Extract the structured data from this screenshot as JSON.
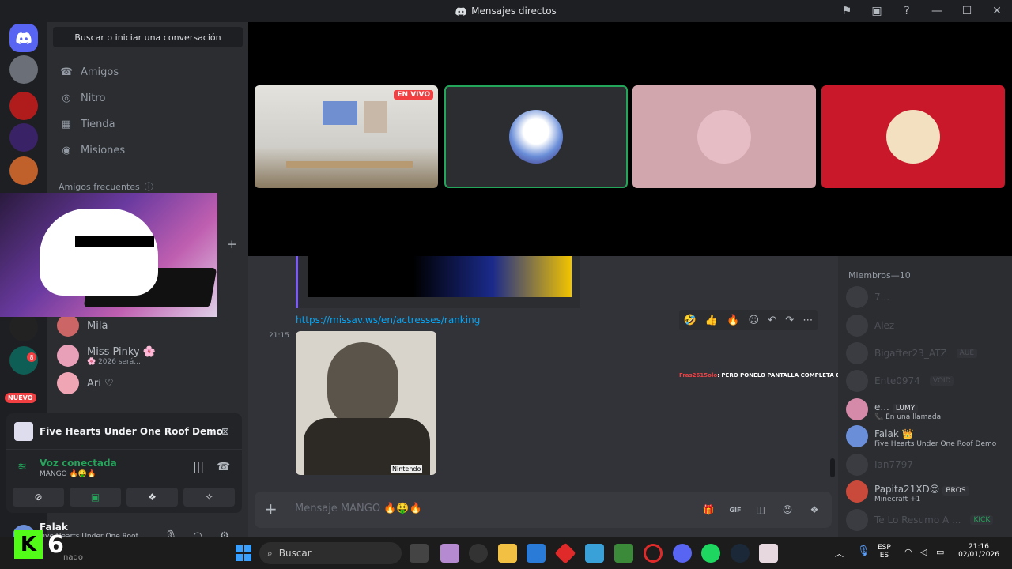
{
  "window": {
    "title": "Mensajes directos"
  },
  "sidebar": {
    "search_label": "Buscar o iniciar una conversación",
    "nav": [
      "Amigos",
      "Nitro",
      "Tienda",
      "Misiones"
    ],
    "section_title": "Amigos frecuentes",
    "dms": [
      {
        "name": "Mila",
        "sub": ""
      },
      {
        "name": "Miss Pinky 🌸",
        "sub": "🌸 2026 será..."
      },
      {
        "name": "Ari ♡",
        "sub": ""
      }
    ],
    "badge_new": "NUEVO",
    "badge_count": "8"
  },
  "activity": {
    "game": "Five Hearts Under One Roof Demo",
    "voice_status": "Voz conectada",
    "channel": "MANGO 🔥🤑🔥"
  },
  "user": {
    "name": "Falak",
    "status": "Five Hearts Under One Roof..."
  },
  "stream": {
    "live_label": "EN VIVO"
  },
  "chat": {
    "link": "https://missav.ws/en/actresses/ranking",
    "time": "21:15",
    "photo_caption": "Nintendo",
    "comment_user": "Fras2615olo",
    "comment_text": ": PERO PONELO PANTALLA COMPLETA QE ME AGO PAJA",
    "placeholder": "Mensaje MANGO 🔥🤑🔥"
  },
  "members": {
    "title": "Miembros—10",
    "list": [
      {
        "name": "7...",
        "sub": "",
        "tag": ""
      },
      {
        "name": "Alez",
        "sub": "",
        "tag": ""
      },
      {
        "name": "Bigafter23_ATZ",
        "sub": "",
        "tag": "AUE"
      },
      {
        "name": "Ente0974",
        "sub": "",
        "tag": "VOID"
      },
      {
        "name": "e...",
        "sub": "📞 En una llamada",
        "tag": "LUMY"
      },
      {
        "name": "Falak 👑",
        "sub": "Five Hearts Under One Roof Demo",
        "tag": ""
      },
      {
        "name": "Ian7797",
        "sub": "",
        "tag": ""
      },
      {
        "name": "Papita21XD😍",
        "sub": "Minecraft +1",
        "tag": "BROS"
      },
      {
        "name": "Te Lo Resumo A ...",
        "sub": "",
        "tag": "KICK"
      }
    ]
  },
  "taskbar": {
    "search": "Buscar",
    "lang": "ESP",
    "lang2": "ES",
    "time": "21:16",
    "date": "02/01/2026",
    "overlay_text": "6",
    "overlay_k": "K",
    "bottom_left": "nado"
  }
}
